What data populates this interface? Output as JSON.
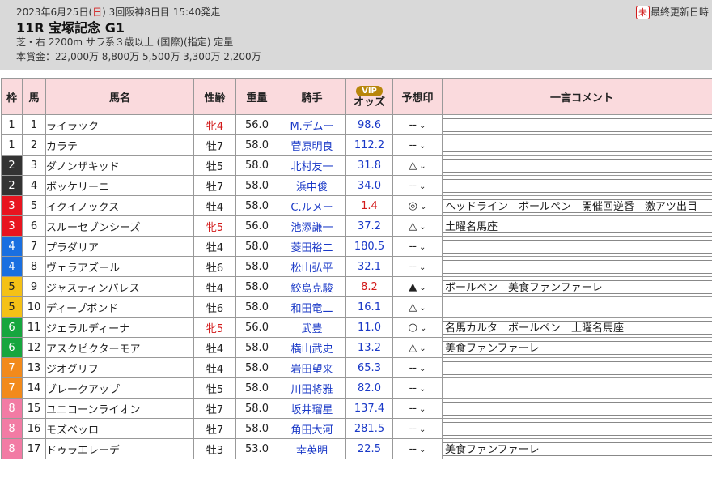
{
  "header": {
    "date_prefix": "2023年6月25日(",
    "date_day": "日",
    "date_suffix": ") 3回阪神8日目 15:40発走",
    "title": "11R 宝塚記念 G1",
    "conditions": "芝・右 2200m サラ系３歳以上 (国際)(指定) 定量",
    "prize": "本賞金：22,000万 8,800万 5,500万 3,300万 2,200万",
    "update_badge": "未",
    "update_label": "最終更新日時"
  },
  "columns": {
    "waku": "枠",
    "umaban": "馬",
    "name": "馬名",
    "sex_age": "性齢",
    "weight": "重量",
    "jockey": "騎手",
    "vip_badge": "VIP",
    "odds": "オッズ",
    "prediction": "予想印",
    "comment": "一言コメント"
  },
  "colors": {
    "header_bg": "#d9d9d9",
    "column_header_bg": "#fadadd",
    "jockey_blue": "#1a39c7",
    "red": "#d21a1a"
  },
  "rows": [
    {
      "waku": "1",
      "umaban": "1",
      "name": "ライラック",
      "sex_age": "牝4",
      "weight": "56.0",
      "jockey": "M.デムー",
      "odds": "98.6",
      "pred": "--",
      "comment": ""
    },
    {
      "waku": "1",
      "umaban": "2",
      "name": "カラテ",
      "sex_age": "牡7",
      "weight": "58.0",
      "jockey": "菅原明良",
      "odds": "112.2",
      "pred": "--",
      "comment": ""
    },
    {
      "waku": "2",
      "umaban": "3",
      "name": "ダノンザキッド",
      "sex_age": "牡5",
      "weight": "58.0",
      "jockey": "北村友一",
      "odds": "31.8",
      "pred": "△",
      "comment": ""
    },
    {
      "waku": "2",
      "umaban": "4",
      "name": "ボッケリーニ",
      "sex_age": "牡7",
      "weight": "58.0",
      "jockey": "浜中俊",
      "odds": "34.0",
      "pred": "--",
      "comment": ""
    },
    {
      "waku": "3",
      "umaban": "5",
      "name": "イクイノックス",
      "sex_age": "牡4",
      "weight": "58.0",
      "jockey": "C.ルメー",
      "odds": "1.4",
      "pred": "◎",
      "comment": "ヘッドライン　ボールペン　開催回逆番　激アツ出目"
    },
    {
      "waku": "3",
      "umaban": "6",
      "name": "スルーセブンシーズ",
      "sex_age": "牝5",
      "weight": "56.0",
      "jockey": "池添謙一",
      "odds": "37.2",
      "pred": "△",
      "comment": "土曜名馬座"
    },
    {
      "waku": "4",
      "umaban": "7",
      "name": "プラダリア",
      "sex_age": "牡4",
      "weight": "58.0",
      "jockey": "菱田裕二",
      "odds": "180.5",
      "pred": "--",
      "comment": ""
    },
    {
      "waku": "4",
      "umaban": "8",
      "name": "ヴェラアズール",
      "sex_age": "牡6",
      "weight": "58.0",
      "jockey": "松山弘平",
      "odds": "32.1",
      "pred": "--",
      "comment": ""
    },
    {
      "waku": "5",
      "umaban": "9",
      "name": "ジャスティンパレス",
      "sex_age": "牡4",
      "weight": "58.0",
      "jockey": "鮫島克駿",
      "odds": "8.2",
      "pred": "▲",
      "comment": "ボールペン　美食ファンファーレ"
    },
    {
      "waku": "5",
      "umaban": "10",
      "name": "ディープボンド",
      "sex_age": "牡6",
      "weight": "58.0",
      "jockey": "和田竜二",
      "odds": "16.1",
      "pred": "△",
      "comment": ""
    },
    {
      "waku": "6",
      "umaban": "11",
      "name": "ジェラルディーナ",
      "sex_age": "牝5",
      "weight": "56.0",
      "jockey": "武豊",
      "odds": "11.0",
      "pred": "○",
      "comment": "名馬カルタ　ボールペン　土曜名馬座"
    },
    {
      "waku": "6",
      "umaban": "12",
      "name": "アスクビクターモア",
      "sex_age": "牡4",
      "weight": "58.0",
      "jockey": "横山武史",
      "odds": "13.2",
      "pred": "△",
      "comment": "美食ファンファーレ"
    },
    {
      "waku": "7",
      "umaban": "13",
      "name": "ジオグリフ",
      "sex_age": "牡4",
      "weight": "58.0",
      "jockey": "岩田望来",
      "odds": "65.3",
      "pred": "--",
      "comment": ""
    },
    {
      "waku": "7",
      "umaban": "14",
      "name": "ブレークアップ",
      "sex_age": "牡5",
      "weight": "58.0",
      "jockey": "川田将雅",
      "odds": "82.0",
      "pred": "--",
      "comment": ""
    },
    {
      "waku": "8",
      "umaban": "15",
      "name": "ユニコーンライオン",
      "sex_age": "牡7",
      "weight": "58.0",
      "jockey": "坂井瑠星",
      "odds": "137.4",
      "pred": "--",
      "comment": ""
    },
    {
      "waku": "8",
      "umaban": "16",
      "name": "モズベッロ",
      "sex_age": "牡7",
      "weight": "58.0",
      "jockey": "角田大河",
      "odds": "281.5",
      "pred": "--",
      "comment": ""
    },
    {
      "waku": "8",
      "umaban": "17",
      "name": "ドゥラエレーデ",
      "sex_age": "牡3",
      "weight": "53.0",
      "jockey": "幸英明",
      "odds": "22.5",
      "pred": "--",
      "comment": "美食ファンファーレ"
    }
  ]
}
